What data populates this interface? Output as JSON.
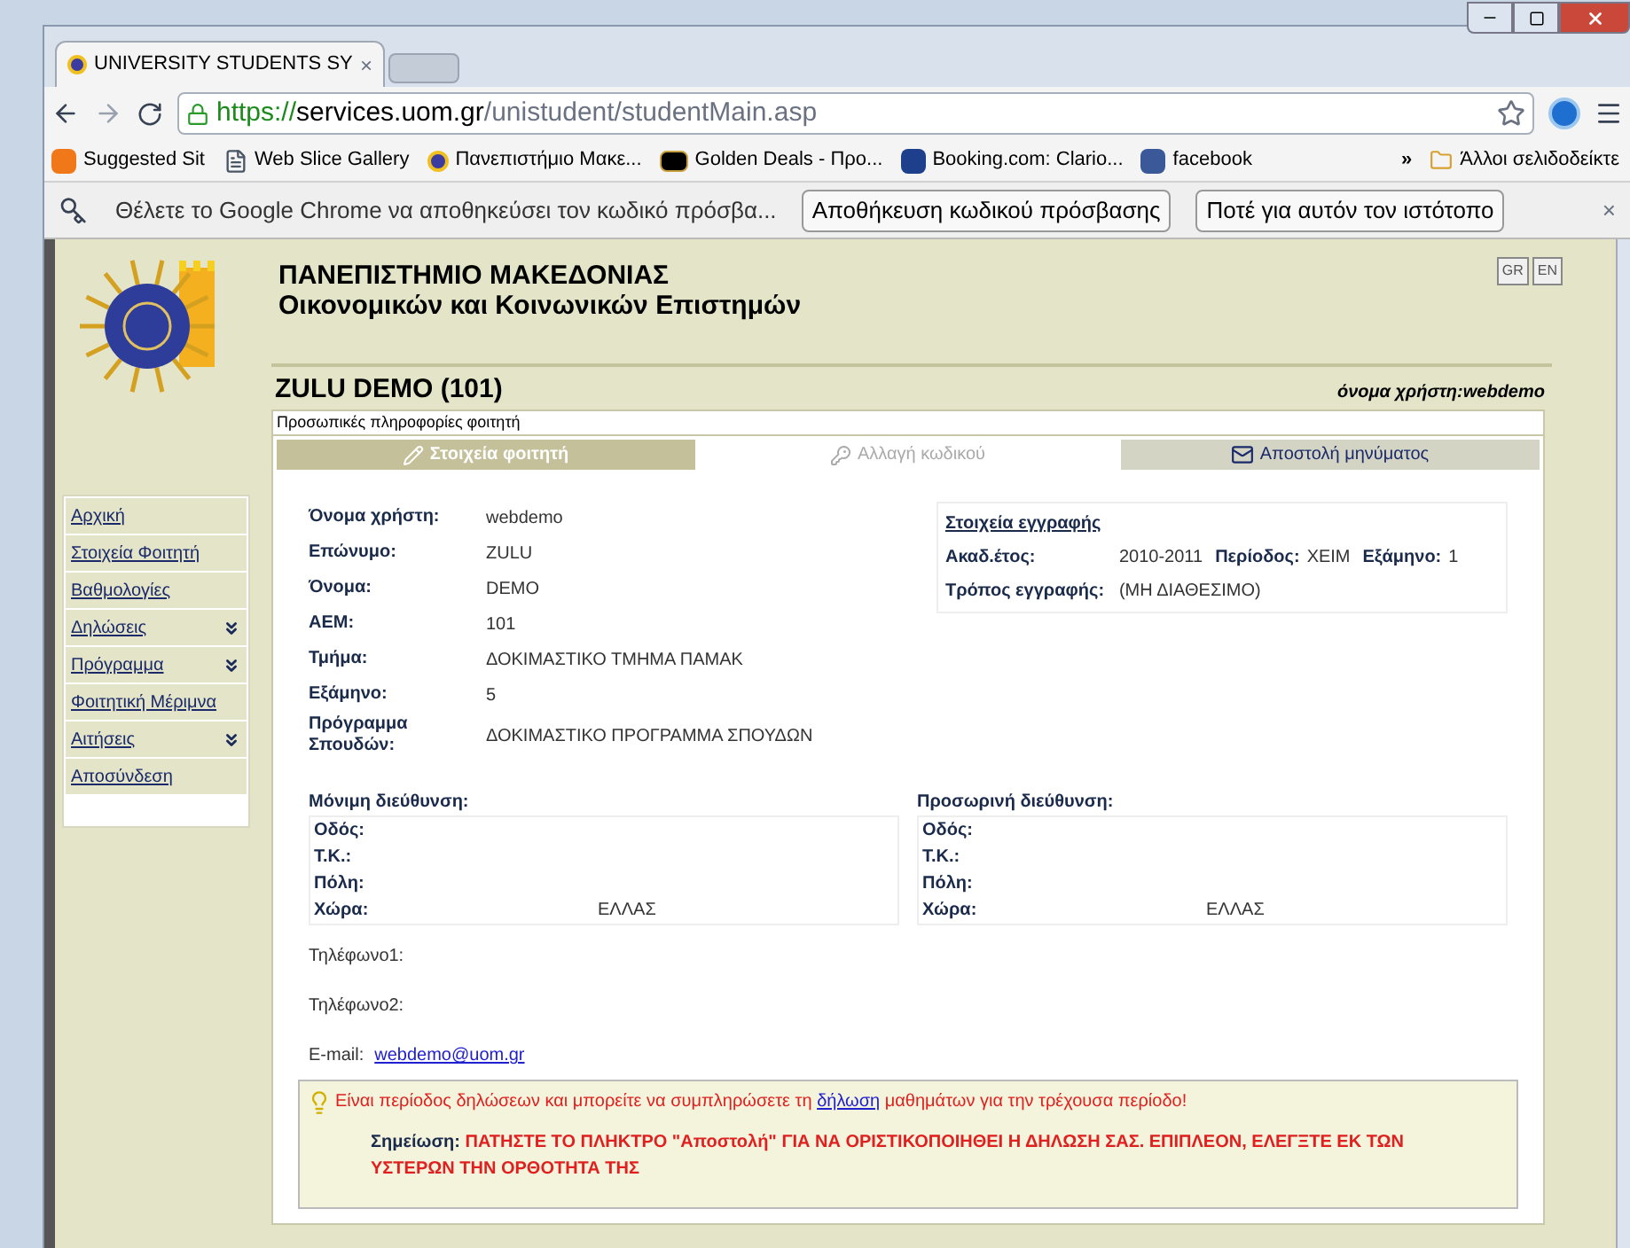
{
  "browser": {
    "tab_title": "UNIVERSITY STUDENTS SY",
    "tab_close": "×",
    "url": {
      "scheme": "https://",
      "host": "services.uom.gr",
      "path": "/unistudent/studentMain.asp"
    },
    "bookmarks": [
      {
        "label": "Suggested Sit",
        "kind": "suggested"
      },
      {
        "label": "Web Slice Gallery",
        "kind": "page"
      },
      {
        "label": "Πανεπιστήμιο Μακε...",
        "kind": "uni"
      },
      {
        "label": "Golden Deals - Προ...",
        "kind": "deals"
      },
      {
        "label": "Booking.com: Clario...",
        "kind": "booking"
      },
      {
        "label": "facebook",
        "kind": "facebook"
      }
    ],
    "more": "»",
    "other_bookmarks": "Άλλοι σελιδοδείκτε",
    "infobar": {
      "message": "Θέλετε το Google Chrome να αποθηκεύσει τον κωδικό πρόσβα...",
      "buttons": [
        "Αποθήκευση κωδικού πρόσβασης",
        "Ποτέ για αυτόν τον ιστότοπο"
      ],
      "close": "×"
    }
  },
  "header": {
    "lines": [
      "ΠΑΝΕΠΙΣΤΗΜΙΟ ΜΑΚΕΔΟΝΙΑΣ",
      "Οικονομικών και Κοινωνικών Επιστημών"
    ],
    "languages": [
      "GR",
      "EN"
    ]
  },
  "sidebar": {
    "items": [
      {
        "label": "Αρχική",
        "expandable": false
      },
      {
        "label": "Στοιχεία Φοιτητή",
        "expandable": false
      },
      {
        "label": "Βαθμολογίες",
        "expandable": false
      },
      {
        "label": "Δηλώσεις",
        "expandable": true
      },
      {
        "label": "Πρόγραμμα",
        "expandable": true
      },
      {
        "label": "Φοιτητική Μέριμνα",
        "expandable": false
      },
      {
        "label": "Αιτήσεις",
        "expandable": true
      },
      {
        "label": "Αποσύνδεση",
        "expandable": false
      }
    ]
  },
  "student_heading": "ZULU DEMO (101)",
  "username": "όνομα χρήστη:webdemo",
  "section_title": "Προσωπικές πληροφορίες φοιτητή",
  "tabs": [
    {
      "label": "Στοιχεία φοιτητή",
      "kind": "edit",
      "selected": true,
      "disabled": false
    },
    {
      "label": "Αλλαγή κωδικού",
      "kind": "keys",
      "selected": false,
      "disabled": true
    },
    {
      "label": "Αποστολή μηνύματος",
      "kind": "mail",
      "selected": false,
      "disabled": false
    }
  ],
  "personal": [
    {
      "label": "Όνομα χρήστη:",
      "value": "webdemo"
    },
    {
      "label": "Επώνυμο:",
      "value": "ZULU"
    },
    {
      "label": "Όνομα:",
      "value": "DEMO"
    },
    {
      "label": "ΑΕΜ:",
      "value": "101"
    },
    {
      "label": "Τμήμα:",
      "value": "ΔΟΚΙΜΑΣΤΙΚΟ ΤΜΗΜΑ ΠΑΜΑΚ"
    },
    {
      "label": "Εξάμηνο:",
      "value": "5"
    },
    {
      "label": "Πρόγραμμα Σπουδών:",
      "value": "ΔΟΚΙΜΑΣΤΙΚΟ ΠΡΟΓΡΑΜΜΑ ΣΠΟΥΔΩΝ"
    }
  ],
  "registration": {
    "title": "Στοιχεία εγγραφής",
    "rows": [
      {
        "label": "Ακαδ.έτος:",
        "parts": [
          {
            "kind": "value",
            "text": "2010-2011"
          },
          {
            "kind": "label",
            "text": "Περίοδος:"
          },
          {
            "kind": "value",
            "text": "ΧΕΙΜ"
          },
          {
            "kind": "label",
            "text": "Εξάμηνο:"
          },
          {
            "kind": "value",
            "text": "1"
          }
        ]
      },
      {
        "label": "Τρόπος εγγραφής:",
        "parts": [
          {
            "kind": "value",
            "text": "(ΜΗ ΔΙΑΘΕΣΙΜΟ)"
          }
        ]
      }
    ]
  },
  "addresses": [
    {
      "title": "Μόνιμη διεύθυνση:",
      "rows": [
        {
          "label": "Οδός:",
          "value": ""
        },
        {
          "label": "Τ.Κ.:",
          "value": ""
        },
        {
          "label": "Πόλη:",
          "value": ""
        },
        {
          "label": "Χώρα:",
          "value": "ΕΛΛΑΣ"
        }
      ]
    },
    {
      "title": "Προσωρινή διεύθυνση:",
      "rows": [
        {
          "label": "Οδός:",
          "value": ""
        },
        {
          "label": "Τ.Κ.:",
          "value": ""
        },
        {
          "label": "Πόλη:",
          "value": ""
        },
        {
          "label": "Χώρα:",
          "value": "ΕΛΛΑΣ"
        }
      ]
    }
  ],
  "phones": [
    "Τηλέφωνο1:",
    "Τηλέφωνο2:"
  ],
  "email": {
    "label": "E-mail:",
    "value": "webdemo@uom.gr"
  },
  "notice": {
    "before": "Είναι περίοδος δηλώσεων και μπορείτε να συμπληρώσετε τη ",
    "link": "δήλωση",
    "after": " μαθημάτων για την τρέχουσα περίοδο!",
    "note_label": "Σημείωση:",
    "note": "ΠΑΤΗΣΤΕ ΤΟ ΠΛΗΚΤΡΟ \"Αποστολή\" ΓΙΑ ΝΑ ΟΡΙΣΤΙΚΟΠΟΙΗΘΕΙ Η ΔΗΛΩΣΗ ΣΑΣ. ΕΠΙΠΛΕΟΝ, ΕΛΕΓΞΤΕ ΕΚ ΤΩΝ ΥΣΤΕΡΩΝ ΤΗΝ ΟΡΘΟΤΗΤΑ ΤΗΣ"
  }
}
